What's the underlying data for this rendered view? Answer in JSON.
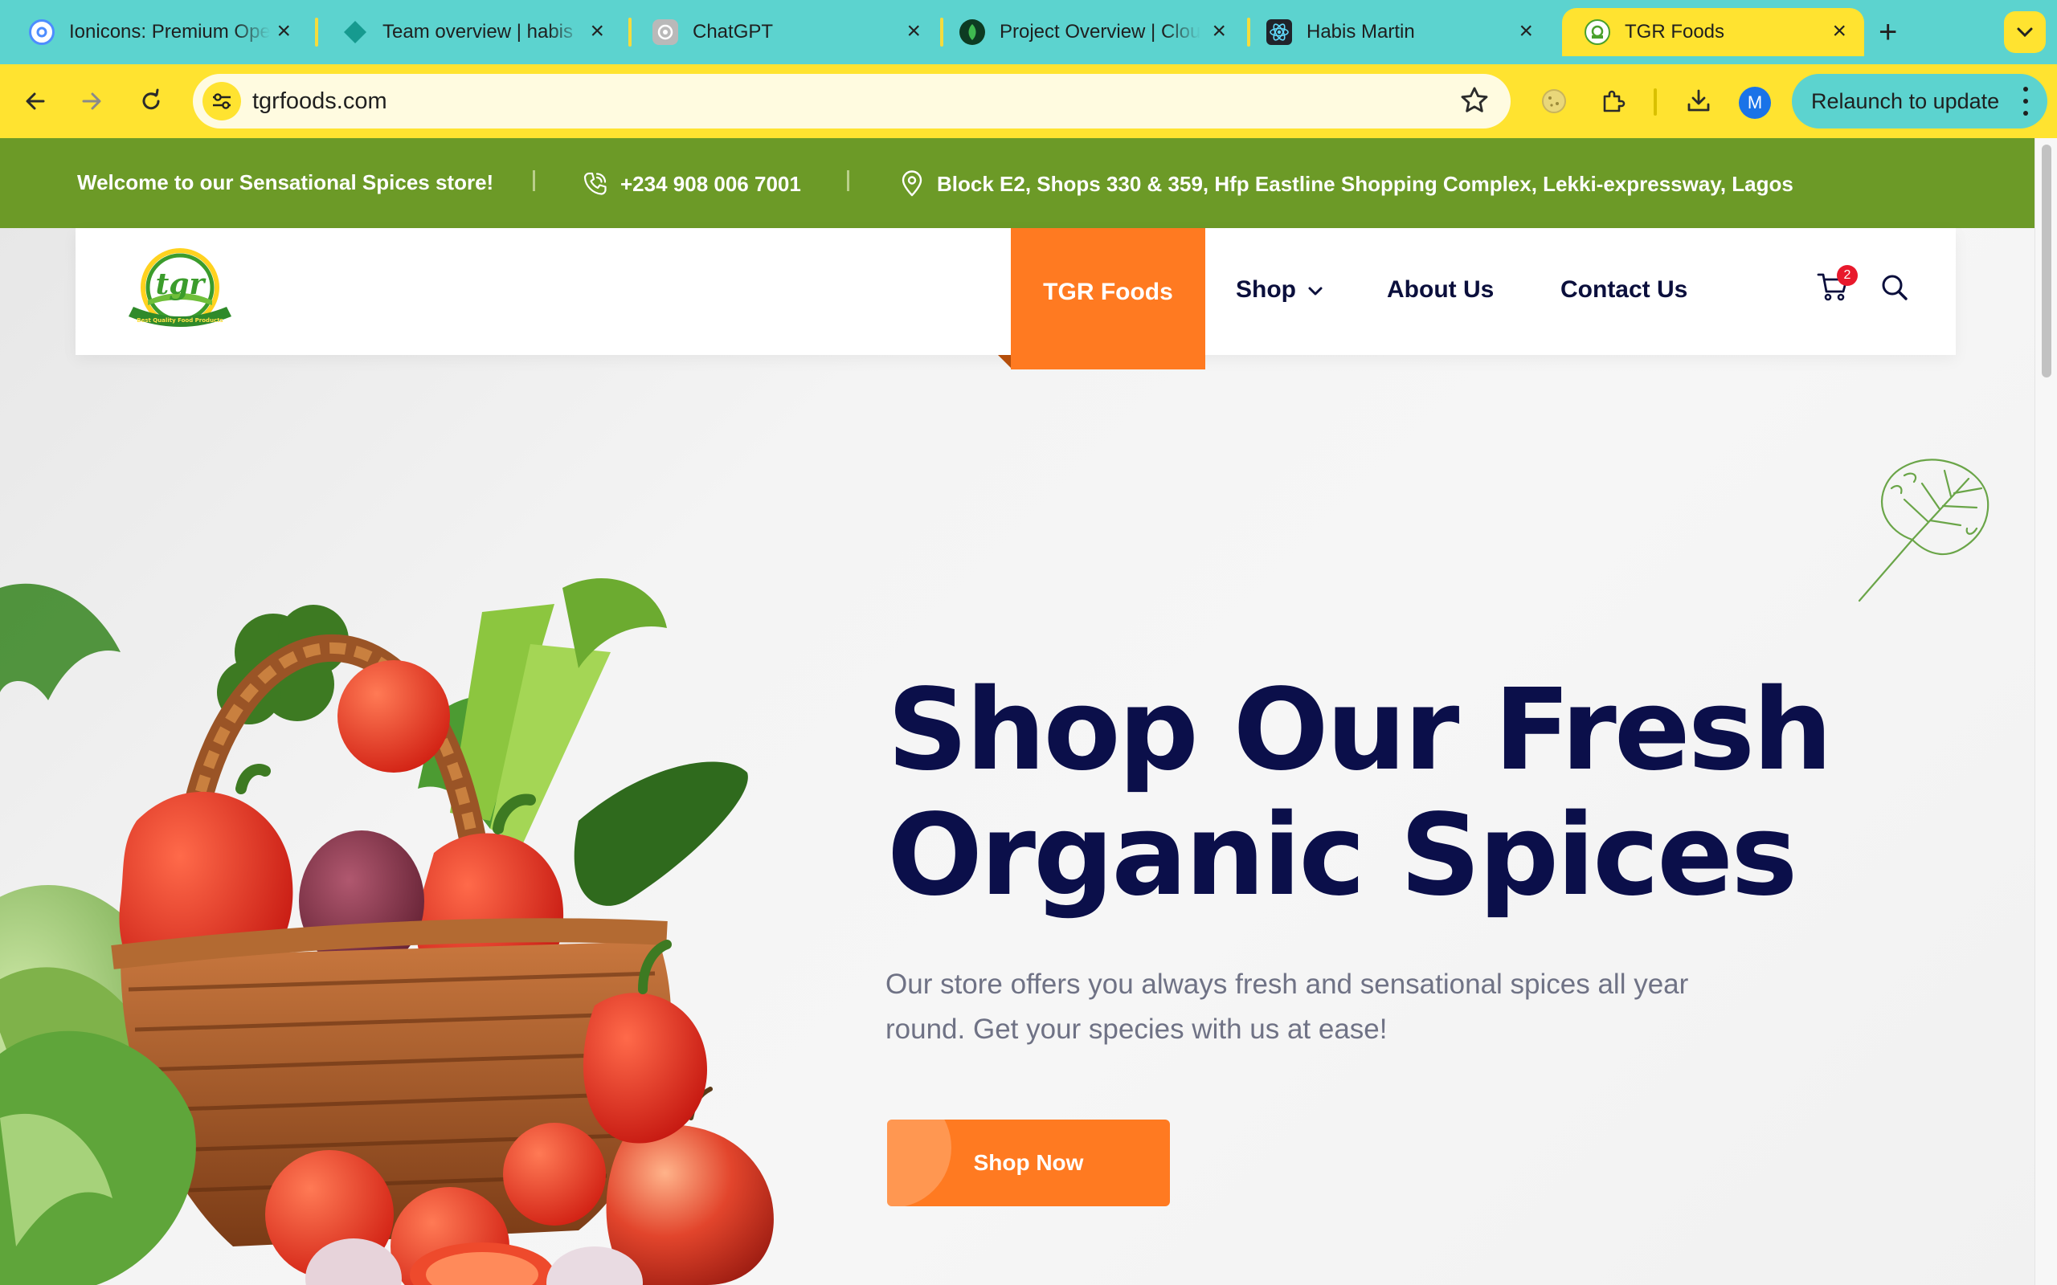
{
  "browser": {
    "tabs": [
      {
        "title": "Ionicons: Premium Open Source Icons",
        "icon": "ionicons-icon"
      },
      {
        "title": "Team overview | habis",
        "icon": "diamond-icon"
      },
      {
        "title": "ChatGPT",
        "icon": "chatgpt-icon"
      },
      {
        "title": "Project Overview | Cloud",
        "icon": "leaf-icon"
      },
      {
        "title": "Habis Martin",
        "icon": "react-icon"
      },
      {
        "title": "TGR Foods",
        "icon": "tgr-icon",
        "active": true
      }
    ],
    "url": "tgrfoods.com",
    "profile_initial": "M",
    "relaunch_label": "Relaunch to update"
  },
  "site": {
    "topbar": {
      "welcome": "Welcome to our Sensational Spices store!",
      "phone": "+234 908 006 7001",
      "address": "Block E2, Shops 330 & 359, Hfp Eastline Shopping Complex, Lekki-expressway, Lagos"
    },
    "logo": {
      "text": "tgr",
      "tagline": "Best Quality Food Products"
    },
    "nav": {
      "active": "TGR Foods",
      "shop": "Shop",
      "about": "About Us",
      "contact": "Contact Us"
    },
    "cart_count": "2",
    "hero": {
      "title_line1": "Shop Our Fresh",
      "title_line2": "Organic Spices",
      "subtitle": "Our store offers you always fresh and sensational spices all year round. Get your species with us at ease!",
      "cta": "Shop Now"
    }
  },
  "colors": {
    "tabbar": "#5cd3cf",
    "toolbar": "#ffe330",
    "topbar_green": "#6c9a27",
    "accent_orange": "#ff7a21",
    "heading_navy": "#0b0f4a"
  }
}
